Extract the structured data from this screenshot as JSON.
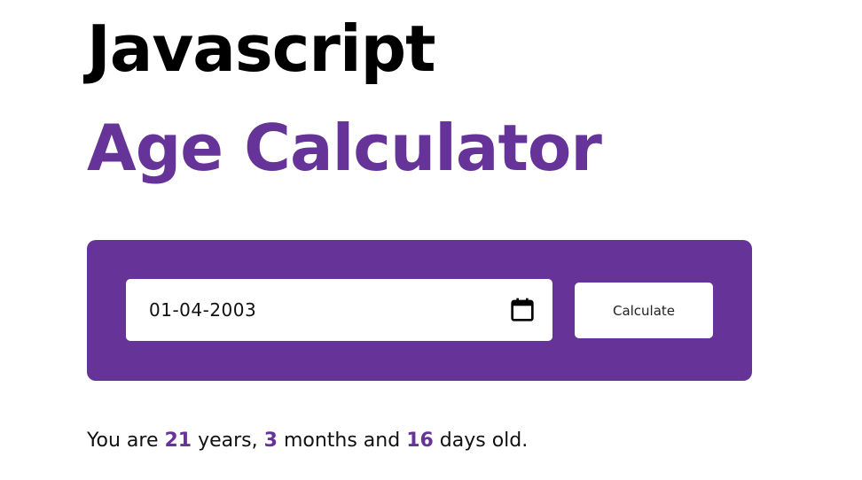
{
  "header": {
    "title": "Javascript",
    "subtitle": "Age Calculator"
  },
  "form": {
    "date_value": "01-04-2003",
    "calendar_icon": "calendar-icon",
    "calculate_label": "Calculate"
  },
  "result": {
    "prefix": "You are ",
    "years": "21",
    "years_label": " years, ",
    "months": "3",
    "months_label": " months and ",
    "days": "16",
    "days_label": " days old."
  },
  "colors": {
    "accent": "#663399",
    "text": "#000000",
    "background": "#ffffff"
  }
}
